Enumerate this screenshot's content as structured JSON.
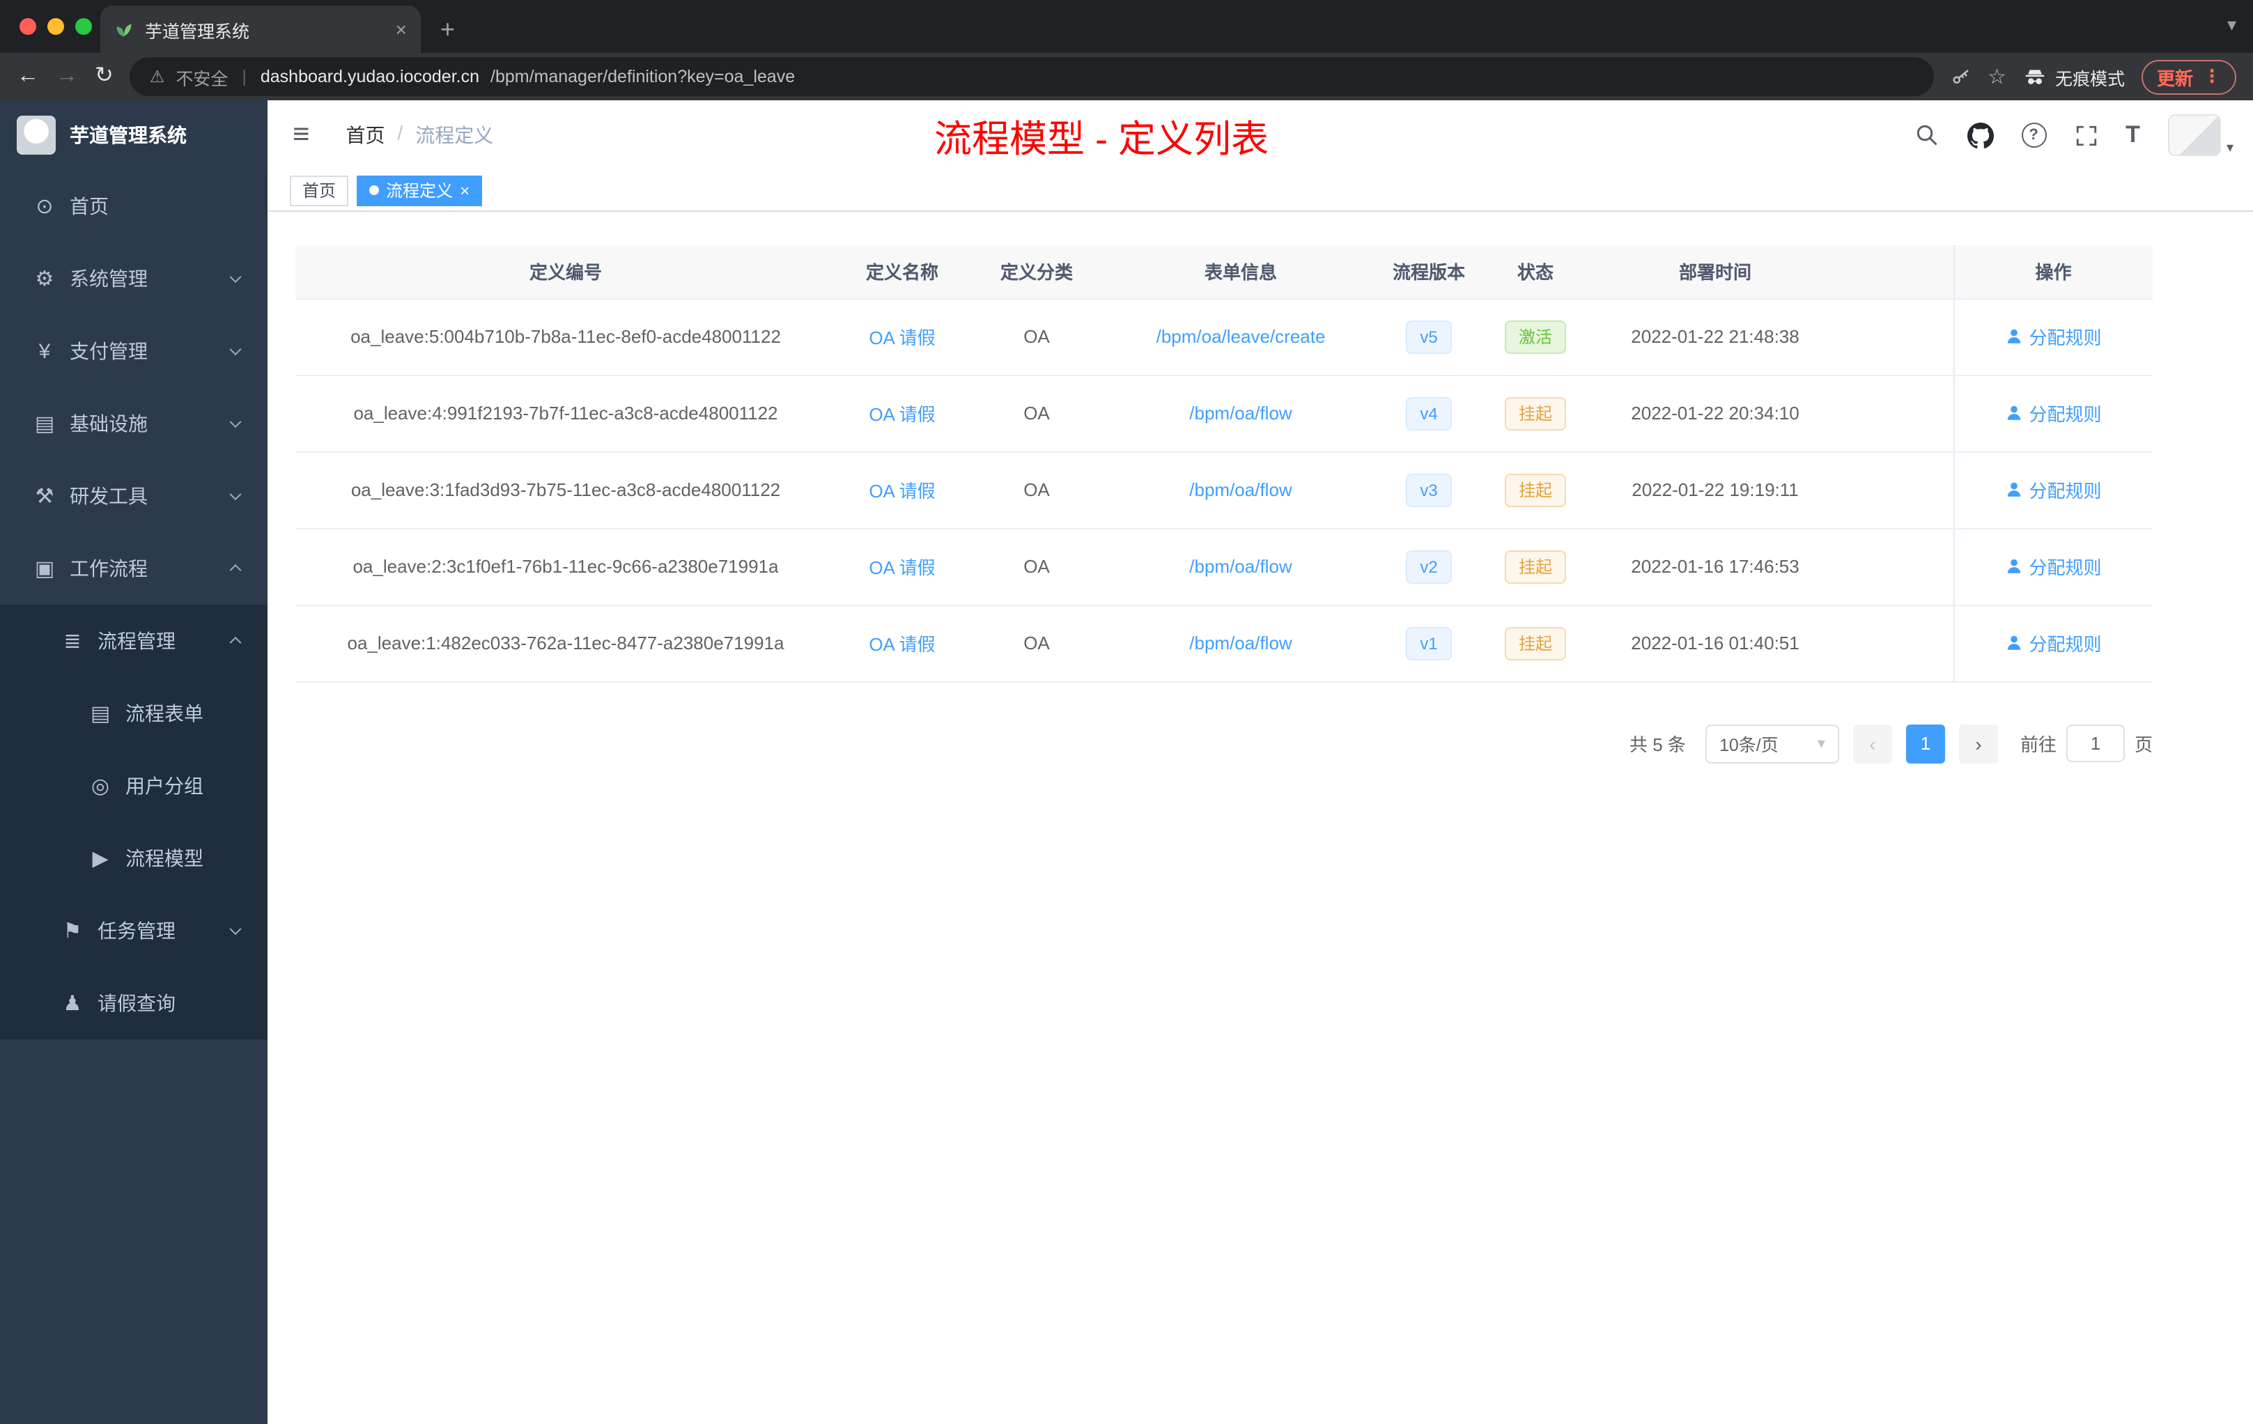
{
  "colors": {
    "accent": "#409eff",
    "sidebar_bg": "#2d3a4b",
    "submenu_bg": "#1f2d3d",
    "success_text": "#67c23a",
    "warning_text": "#e6a23c",
    "annotation_red": "#ff0000",
    "chrome_dark": "#202124",
    "chrome_toolbar": "#35363a"
  },
  "glyphs": {
    "back": "←",
    "forward": "→",
    "reload": "↻",
    "warning": "⚠",
    "star": "☆",
    "plus": "+",
    "close": "×",
    "chevron_down": "▾",
    "dots": "⋮",
    "hamburger": "≡",
    "divider": "|",
    "question": "?",
    "font_size": "T",
    "prev": "‹",
    "next": "›"
  },
  "browser": {
    "tab_title": "芋道管理系统",
    "security_label": "不安全",
    "url_host": "dashboard.yudao.iocoder.cn",
    "url_path": "/bpm/manager/definition?key=oa_leave",
    "incognito_label": "无痕模式",
    "update_label": "更新"
  },
  "sidebar": {
    "logo_title": "芋道管理系统",
    "items": [
      {
        "label": "首页",
        "glyph": "⊙"
      },
      {
        "label": "系统管理",
        "glyph": "⚙"
      },
      {
        "label": "支付管理",
        "glyph": "¥"
      },
      {
        "label": "基础设施",
        "glyph": "▤"
      },
      {
        "label": "研发工具",
        "glyph": "⚒"
      },
      {
        "label": "工作流程",
        "glyph": "▣"
      },
      {
        "label": "流程管理",
        "glyph": "≣"
      },
      {
        "label": "流程表单",
        "glyph": "▤"
      },
      {
        "label": "用户分组",
        "glyph": "◎"
      },
      {
        "label": "流程模型",
        "glyph": "▶"
      },
      {
        "label": "任务管理",
        "glyph": "⚑"
      },
      {
        "label": "请假查询",
        "glyph": "♟"
      }
    ]
  },
  "header": {
    "breadcrumb_home": "首页",
    "breadcrumb_sep": "/",
    "breadcrumb_current": "流程定义",
    "annotation": "流程模型 - 定义列表"
  },
  "tags": {
    "home": "首页",
    "current": "流程定义"
  },
  "table": {
    "columns": [
      "定义编号",
      "定义名称",
      "定义分类",
      "表单信息",
      "流程版本",
      "状态",
      "部署时间",
      "操作"
    ],
    "action_label": "分配规则",
    "rows": [
      {
        "id": "oa_leave:5:004b710b-7b8a-11ec-8ef0-acde48001122",
        "name": "OA 请假",
        "category": "OA",
        "form": "/bpm/oa/leave/create",
        "version": "v5",
        "status": "激活",
        "time": "2022-01-22 21:48:38"
      },
      {
        "id": "oa_leave:4:991f2193-7b7f-11ec-a3c8-acde48001122",
        "name": "OA 请假",
        "category": "OA",
        "form": "/bpm/oa/flow",
        "version": "v4",
        "status": "挂起",
        "time": "2022-01-22 20:34:10"
      },
      {
        "id": "oa_leave:3:1fad3d93-7b75-11ec-a3c8-acde48001122",
        "name": "OA 请假",
        "category": "OA",
        "form": "/bpm/oa/flow",
        "version": "v3",
        "status": "挂起",
        "time": "2022-01-22 19:19:11"
      },
      {
        "id": "oa_leave:2:3c1f0ef1-76b1-11ec-9c66-a2380e71991a",
        "name": "OA 请假",
        "category": "OA",
        "form": "/bpm/oa/flow",
        "version": "v2",
        "status": "挂起",
        "time": "2022-01-16 17:46:53"
      },
      {
        "id": "oa_leave:1:482ec033-762a-11ec-8477-a2380e71991a",
        "name": "OA 请假",
        "category": "OA",
        "form": "/bpm/oa/flow",
        "version": "v1",
        "status": "挂起",
        "time": "2022-01-16 01:40:51"
      }
    ]
  },
  "pagination": {
    "total": "共 5 条",
    "page_size": "10条/页",
    "current_page": "1",
    "goto_label": "前往",
    "goto_value": "1",
    "unit_label": "页"
  }
}
